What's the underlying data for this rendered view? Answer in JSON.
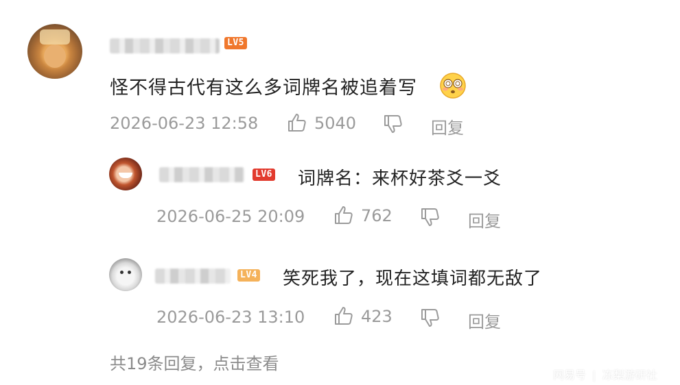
{
  "comment": {
    "level_badge": "LV5",
    "text": "怪不得古代有这么多词牌名被追着写",
    "emoji": "dizzy-face-emoji",
    "time": "2026-06-23 12:58",
    "likes": "5040",
    "reply_label": "回复"
  },
  "replies": [
    {
      "level_badge": "LV6",
      "text": "词牌名：来杯好茶爻一爻",
      "time": "2026-06-25 20:09",
      "likes": "762",
      "reply_label": "回复"
    },
    {
      "level_badge": "LV4",
      "text": "笑死我了，现在这填词都无敌了",
      "time": "2026-06-23 13:10",
      "likes": "423",
      "reply_label": "回复"
    }
  ],
  "more_replies_label": "共19条回复，点击查看",
  "watermark": {
    "brand": "网易号",
    "separator": "|",
    "account": "冻梨游研社"
  },
  "colors": {
    "lv5": "#f0772c",
    "lv6": "#e23b2e",
    "lv4": "#f5b25a",
    "meta_text": "#9a9a9a"
  }
}
